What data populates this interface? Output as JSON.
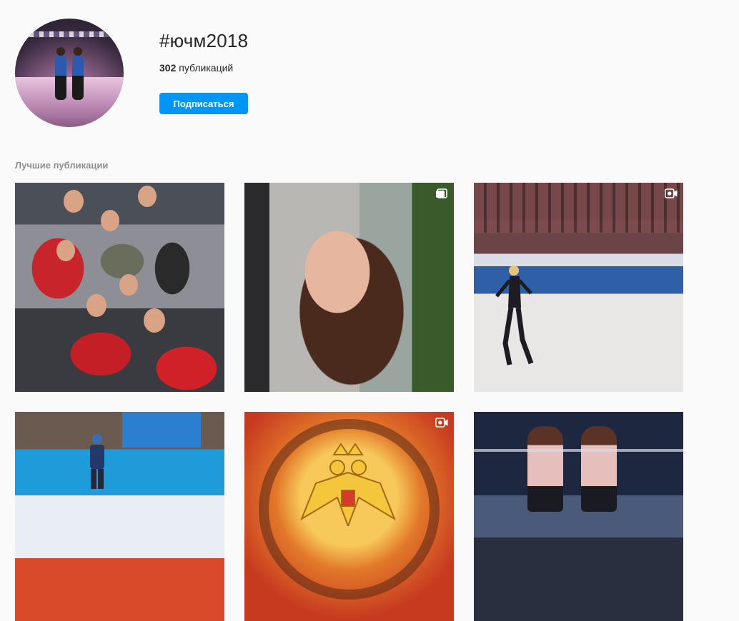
{
  "tag": {
    "title": "#ючм2018",
    "count_value": "302",
    "count_label": "публикаций",
    "follow_label": "Подписаться"
  },
  "sections": {
    "top_posts_label": "Лучшие публикации"
  },
  "posts": [
    {
      "type": "image",
      "badge": ""
    },
    {
      "type": "carousel",
      "badge": "carousel-icon"
    },
    {
      "type": "video",
      "badge": "video-icon"
    },
    {
      "type": "image",
      "badge": ""
    },
    {
      "type": "video",
      "badge": "video-icon"
    },
    {
      "type": "image",
      "badge": ""
    }
  ],
  "colors": {
    "accent": "#0095f6",
    "background": "#fafafa",
    "text": "#262626",
    "muted": "#8e8e8e"
  }
}
